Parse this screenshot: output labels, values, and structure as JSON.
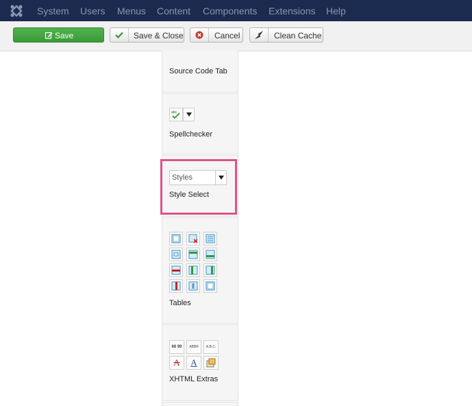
{
  "nav": {
    "items": [
      "System",
      "Users",
      "Menus",
      "Content",
      "Components",
      "Extensions",
      "Help"
    ]
  },
  "toolbar": {
    "save_label": "Save",
    "save_close_label": "Save & Close",
    "cancel_label": "Cancel",
    "clean_cache_label": "Clean Cache"
  },
  "plugins": {
    "source_code_label": "Source Code Tab",
    "spellchecker_label": "Spellchecker",
    "style_select_label": "Style Select",
    "styles_select_value": "Styles",
    "tables_label": "Tables",
    "xhtml_extras_label": "XHTML Extras",
    "xhtml_btn_cite": "66 99",
    "xhtml_btn_abbr": "ABBR",
    "xhtml_btn_acronym": "A.B.C.",
    "xhtml_btn_del": "A",
    "xhtml_btn_ins": "A"
  },
  "colors": {
    "navbar": "#1a2b4f",
    "save_green": "#46a546",
    "highlight": "#e0528a"
  }
}
